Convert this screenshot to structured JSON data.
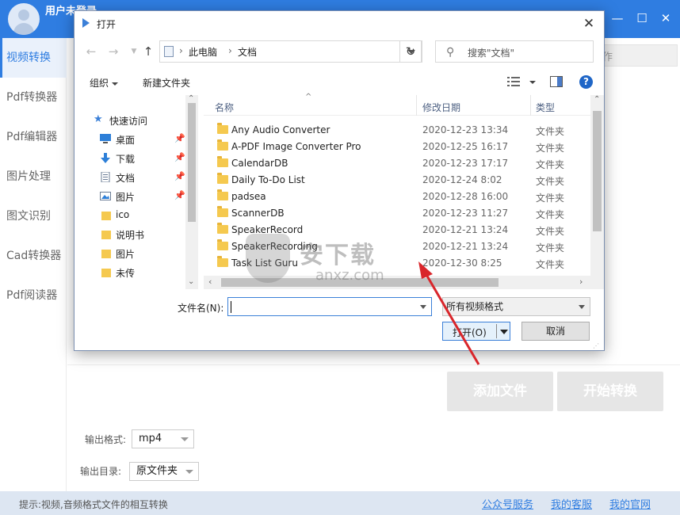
{
  "app": {
    "user_label": "用户未登录",
    "sidebar": [
      {
        "label": "视频转换",
        "active": true
      },
      {
        "label": "Pdf转换器"
      },
      {
        "label": "Pdf编辑器"
      },
      {
        "label": "图片处理"
      },
      {
        "label": "图文识别"
      },
      {
        "label": "Cad转换器"
      },
      {
        "label": "Pdf阅读器"
      }
    ],
    "format_column_hint": "作",
    "add_file_label": "添加文件",
    "start_convert_label": "开始转换",
    "output_format_label": "输出格式:",
    "output_format_value": "mp4",
    "output_dir_label": "输出目录:",
    "output_dir_value": "原文件夹",
    "status_text": "提示:视频,音频格式文件的相互转换",
    "links": [
      "公众号服务",
      "我的客服",
      "我的官网"
    ],
    "accent_color": "#2f7de1"
  },
  "dialog": {
    "title": "打开",
    "address": {
      "crumbs": [
        "此电脑",
        "文档"
      ]
    },
    "search_placeholder": "搜索\"文档\"",
    "toolbar": {
      "organize": "组织",
      "new_folder": "新建文件夹"
    },
    "nav_items": [
      {
        "label": "快速访问",
        "icon": "star-icon"
      },
      {
        "label": "桌面",
        "icon": "desktop-icon",
        "pinned": true
      },
      {
        "label": "下载",
        "icon": "download-icon",
        "pinned": true
      },
      {
        "label": "文档",
        "icon": "document-icon",
        "pinned": true
      },
      {
        "label": "图片",
        "icon": "pictures-icon",
        "pinned": true
      },
      {
        "label": "ico",
        "icon": "folder-icon"
      },
      {
        "label": "说明书",
        "icon": "folder-icon"
      },
      {
        "label": "图片",
        "icon": "folder-icon"
      },
      {
        "label": "未传",
        "icon": "folder-icon"
      }
    ],
    "columns": {
      "name": "名称",
      "date": "修改日期",
      "type": "类型"
    },
    "files": [
      {
        "name": "Any Audio Converter",
        "date": "2020-12-23 13:34",
        "type": "文件夹"
      },
      {
        "name": "A-PDF Image Converter Pro",
        "date": "2020-12-25 16:17",
        "type": "文件夹"
      },
      {
        "name": "CalendarDB",
        "date": "2020-12-23 17:17",
        "type": "文件夹"
      },
      {
        "name": "Daily To-Do List",
        "date": "2020-12-24 8:02",
        "type": "文件夹"
      },
      {
        "name": "padsea",
        "date": "2020-12-28 16:00",
        "type": "文件夹"
      },
      {
        "name": "ScannerDB",
        "date": "2020-12-23 11:27",
        "type": "文件夹"
      },
      {
        "name": "SpeakerRecord",
        "date": "2020-12-21 13:24",
        "type": "文件夹"
      },
      {
        "name": "SpeakerRecording",
        "date": "2020-12-21 13:24",
        "type": "文件夹"
      },
      {
        "name": "Task List Guru",
        "date": "2020-12-30 8:25",
        "type": "文件夹"
      }
    ],
    "filename_label": "文件名(N):",
    "filename_value": "",
    "filetype_value": "所有视频格式",
    "open_label": "打开(O)",
    "cancel_label": "取消"
  },
  "watermark": {
    "text": "安下载",
    "subtext": "anxz.com"
  }
}
